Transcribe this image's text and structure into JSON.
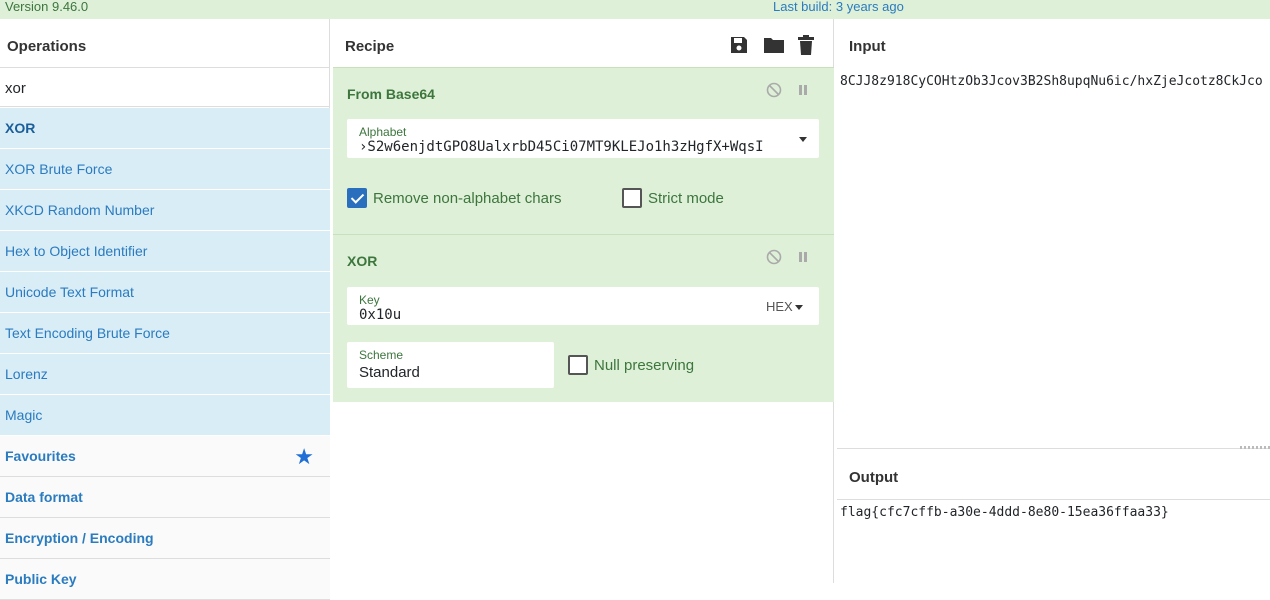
{
  "banner": {
    "version": "Version 9.46.0",
    "last_build": "Last build: 3 years ago"
  },
  "operations": {
    "title": "Operations",
    "search_value": "xor",
    "results": [
      {
        "label": "XOR"
      },
      {
        "label": "XOR Brute Force"
      },
      {
        "label": "XKCD Random Number"
      },
      {
        "label": "Hex to Object Identifier"
      },
      {
        "label": "Unicode Text Format"
      },
      {
        "label": "Text Encoding Brute Force"
      },
      {
        "label": "Lorenz"
      },
      {
        "label": "Magic"
      }
    ],
    "categories": [
      {
        "label": "Favourites",
        "icon": "star-icon"
      },
      {
        "label": "Data format"
      },
      {
        "label": "Encryption / Encoding"
      },
      {
        "label": "Public Key"
      }
    ]
  },
  "recipe": {
    "title": "Recipe",
    "icons": [
      "save-icon",
      "folder-icon",
      "trash-icon"
    ],
    "from_base64": {
      "title": "From Base64",
      "alphabet_label": "Alphabet",
      "alphabet_value": "›S2w6enjdtGPO8UalxrbD45Ci07MT9KLEJo1h3zHgfX+WqsI",
      "remove_non_alphabet": {
        "label": "Remove non-alphabet chars",
        "checked": true
      },
      "strict_mode": {
        "label": "Strict mode",
        "checked": false
      }
    },
    "xor": {
      "title": "XOR",
      "key_label": "Key",
      "key_value": "0x10u",
      "key_format": "HEX",
      "scheme_label": "Scheme",
      "scheme_value": "Standard",
      "null_preserving": {
        "label": "Null preserving",
        "checked": false
      }
    }
  },
  "input": {
    "title": "Input",
    "text": "8CJJ8z918CyCOHtzOb3Jcov3B2Sh8upqNu6ic/hxZjeJcotz8CkJco"
  },
  "output": {
    "title": "Output",
    "text": "flag{cfc7cffb-a30e-4ddd-8e80-15ea36ffaa33}"
  },
  "colors": {
    "accent": "#2a7bbf",
    "recipe_bg": "#dff0d8",
    "results_bg": "#d9edf7",
    "green_text": "#3c763d"
  }
}
